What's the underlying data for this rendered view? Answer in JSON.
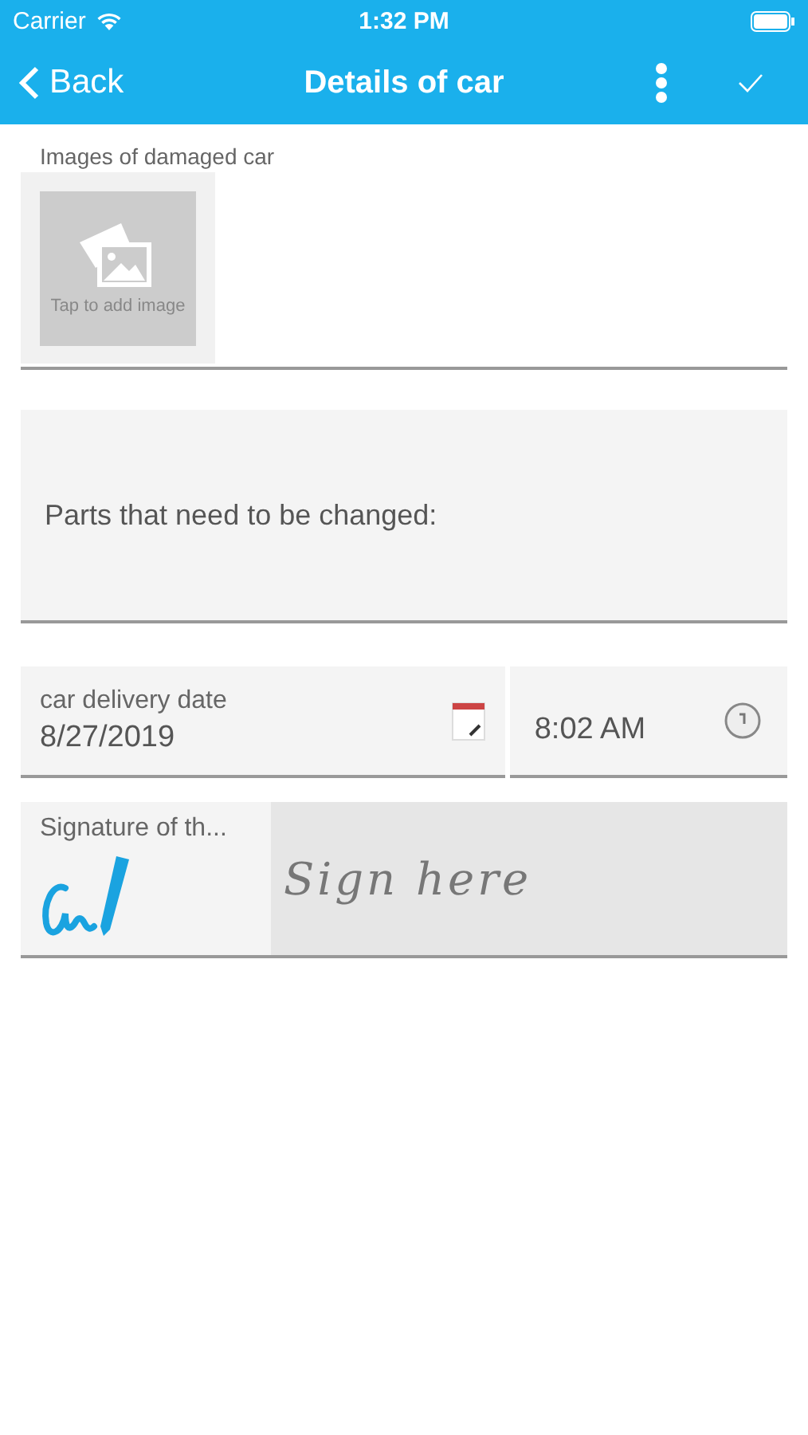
{
  "status_bar": {
    "carrier": "Carrier",
    "time": "1:32 PM"
  },
  "nav_bar": {
    "back": "Back",
    "title": "Details of car"
  },
  "images": {
    "label": "Images of damaged car",
    "add_hint": "Tap to add image"
  },
  "parts": {
    "placeholder": "Parts that need to be changed:"
  },
  "delivery": {
    "label": "car delivery date",
    "date": "8/27/2019",
    "time": "8:02 AM"
  },
  "signature": {
    "label": "Signature of th...",
    "placeholder": "Sign here"
  }
}
